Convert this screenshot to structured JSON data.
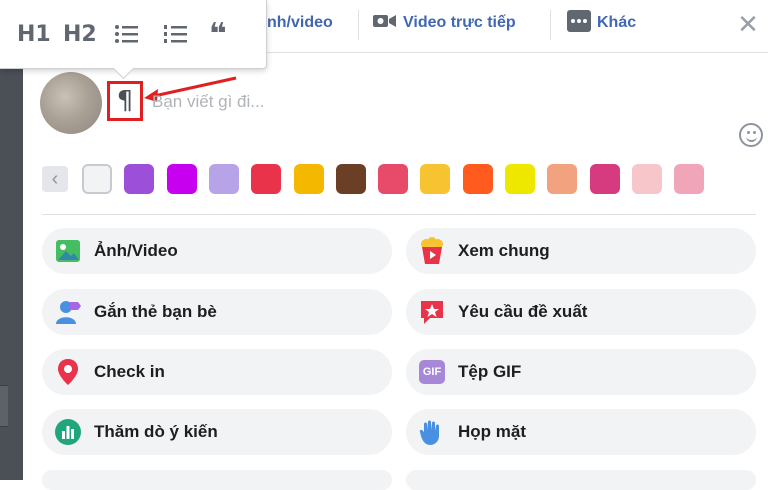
{
  "format_toolbar": {
    "h1": "H1",
    "h2": "H2",
    "bullet_list_icon": "bullet-list-icon",
    "numbered_list_icon": "numbered-list-icon",
    "quote_icon": "quote-icon",
    "quote_glyph": "❝"
  },
  "tabs": [
    {
      "label": "nh/video",
      "icon": "photo-video-icon"
    },
    {
      "label": "Video trực tiếp",
      "icon": "video-camera-icon"
    },
    {
      "label": "Khác",
      "icon": "more-icon"
    }
  ],
  "composer": {
    "placeholder": "Bạn viết gì đi...",
    "pilcrow": "¶",
    "emoji_icon": "emoji-icon"
  },
  "annotation": {
    "color": "#e02020"
  },
  "backgrounds": {
    "selected_index": 0,
    "colors": [
      "#f2f3f5",
      "#9c4fd8",
      "#c800f0",
      "#b7a3e8",
      "#e8334a",
      "#f5b800",
      "#6b3e26",
      "#e84a6a",
      "#f7c331",
      "#ff5b1f",
      "#eee700",
      "#f2a27f",
      "#d63a7f",
      "#f7c6cb",
      "#f0a5b8"
    ]
  },
  "options": [
    {
      "label": "Ảnh/Video",
      "icon": "photo-icon"
    },
    {
      "label": "Xem chung",
      "icon": "popcorn-icon"
    },
    {
      "label": "Gắn thẻ bạn bè",
      "icon": "tag-friends-icon"
    },
    {
      "label": "Yêu cầu đề xuất",
      "icon": "recommendation-icon"
    },
    {
      "label": "Check in",
      "icon": "location-pin-icon"
    },
    {
      "label": "Tệp GIF",
      "icon": "gif-icon",
      "glyph": "GIF"
    },
    {
      "label": "Thăm dò ý kiến",
      "icon": "poll-icon"
    },
    {
      "label": "Họp mặt",
      "icon": "wave-hand-icon"
    }
  ],
  "colors": {
    "brand_blue": "#4267b2",
    "text": "#1c1e21",
    "button_bg": "#f2f3f5"
  }
}
